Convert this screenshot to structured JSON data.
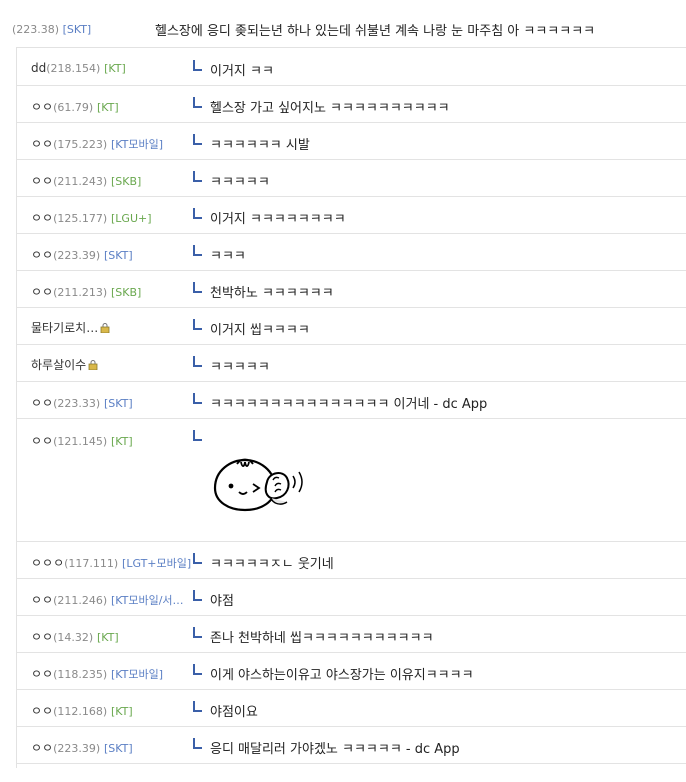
{
  "post": {
    "ip": "(223.38)",
    "isp": "[SKT]",
    "text": "헬스장에 응디 좆되는년 하나 있는데 쉬불년 계속 나랑 눈 마주침 아 ㅋㅋㅋㅋㅋㅋ"
  },
  "replies": [
    {
      "nick": "dd",
      "ip": "(218.154)",
      "isp": "[KT]",
      "text": "이거지 ㅋㅋ"
    },
    {
      "nick": "ㅇㅇ",
      "ip": "(61.79)",
      "isp": "[KT]",
      "text": "헬스장 가고 싶어지노 ㅋㅋㅋㅋㅋㅋㅋㅋㅋㅋ"
    },
    {
      "nick": "ㅇㅇ",
      "ip": "(175.223)",
      "isp": "[KT모바일]",
      "text": "ㅋㅋㅋㅋㅋㅋ 시발"
    },
    {
      "nick": "ㅇㅇ",
      "ip": "(211.243)",
      "isp": "[SKB]",
      "text": "ㅋㅋㅋㅋㅋ"
    },
    {
      "nick": "ㅇㅇ",
      "ip": "(125.177)",
      "isp": "[LGU+]",
      "text": "이거지 ㅋㅋㅋㅋㅋㅋㅋㅋ"
    },
    {
      "nick": "ㅇㅇ",
      "ip": "(223.39)",
      "isp": "[SKT]",
      "text": "ㅋㅋㅋ"
    },
    {
      "nick": "ㅇㅇ",
      "ip": "(211.213)",
      "isp": "[SKB]",
      "text": "천박하노 ㅋㅋㅋㅋㅋㅋ"
    },
    {
      "nick": "물타기로치…",
      "ip": "",
      "isp": "",
      "text": "이거지 씹ㅋㅋㅋㅋ"
    },
    {
      "nick": "하루살이수",
      "ip": "",
      "isp": "",
      "text": "ㅋㅋㅋㅋㅋ"
    },
    {
      "nick": "ㅇㅇ",
      "ip": "(223.33)",
      "isp": "[SKT]",
      "text": "ㅋㅋㅋㅋㅋㅋㅋㅋㅋㅋㅋㅋㅋㅋㅋ 이거네 - dc App"
    },
    {
      "nick": "ㅇㅇ",
      "ip": "(121.145)",
      "isp": "[KT]",
      "text": ""
    },
    {
      "nick": "ㅇㅇㅇ",
      "ip": "(117.111)",
      "isp": "[LGT+모바일]",
      "text": "ㅋㅋㅋㅋㅋㅈㄴ 웃기네"
    },
    {
      "nick": "ㅇㅇ",
      "ip": "(211.246)",
      "isp": "[KT모바일/서…",
      "text": "야점"
    },
    {
      "nick": "ㅇㅇ",
      "ip": "(14.32)",
      "isp": "[KT]",
      "text": "존나 천박하네 씹ㅋㅋㅋㅋㅋㅋㅋㅋㅋㅋㅋ"
    },
    {
      "nick": "ㅇㅇ",
      "ip": "(118.235)",
      "isp": "[KT모바일]",
      "text": "이게 야스하는이유고 야스장가는 이유지ㅋㅋㅋㅋ"
    },
    {
      "nick": "ㅇㅇ",
      "ip": "(112.168)",
      "isp": "[KT]",
      "text": "야점이요"
    },
    {
      "nick": "ㅇㅇ",
      "ip": "(223.39)",
      "isp": "[SKT]",
      "text": "응디 매달리러 가야겠노 ㅋㅋㅋㅋㅋ - dc App"
    }
  ],
  "colors": {
    "isp_blue": "#5b7fc4",
    "isp_green": "#6aa84f",
    "marker": "#3a5fa8",
    "border": "#e3e3e3"
  }
}
